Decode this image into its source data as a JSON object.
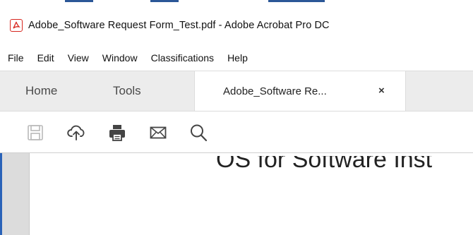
{
  "window": {
    "title": "Adobe_Software Request Form_Test.pdf - Adobe Acrobat Pro DC",
    "accent_color": "#2b5797",
    "app_icon": "acrobat-icon"
  },
  "menubar": {
    "items": [
      "File",
      "Edit",
      "View",
      "Window",
      "Classifications",
      "Help"
    ]
  },
  "tabs": {
    "home_label": "Home",
    "tools_label": "Tools",
    "document_label": "Adobe_Software Re...",
    "close_glyph": "×"
  },
  "toolbar": {
    "icons": [
      "save-icon",
      "cloud-upload-icon",
      "print-icon",
      "email-icon",
      "search-icon"
    ]
  },
  "document": {
    "visible_text": "OS for Software Inst"
  }
}
